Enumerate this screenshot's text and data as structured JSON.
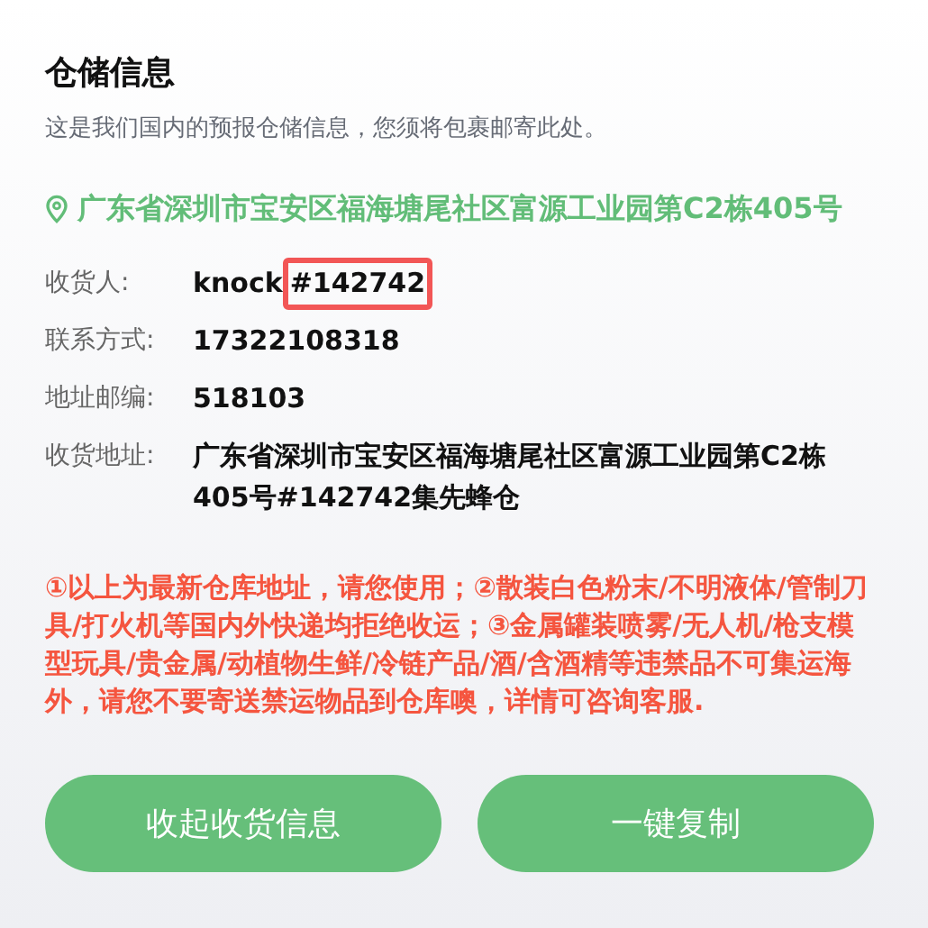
{
  "title": "仓储信息",
  "subtitle": "这是我们国内的预报仓储信息，您须将包裹邮寄此处。",
  "location": "广东省深圳市宝安区福海塘尾社区富源工业园第C2栋405号",
  "fields": [
    {
      "label": "收货人:",
      "value": "knock",
      "tag": {
        "text": "#142742",
        "highlighted": true
      }
    },
    {
      "label": "联系方式:",
      "value": "17322108318"
    },
    {
      "label": "地址邮编:",
      "value": "518103"
    },
    {
      "label": "收货地址:",
      "value": "广东省深圳市宝安区福海塘尾社区富源工业园第C2栋405号#142742集先蜂仓"
    }
  ],
  "notice": "①以上为最新仓库地址，请您使用；②散装白色粉末/不明液体/管制刀具/打火机等国内外快递均拒绝收运；③金属罐装喷雾/无人机/枪支模型玩具/贵金属/动植物生鲜/冷链产品/酒/含酒精等违禁品不可集运海外，请您不要寄送禁运物品到仓库噢，详情可咨询客服.",
  "buttons": [
    "收起收货信息",
    "一键复制"
  ]
}
